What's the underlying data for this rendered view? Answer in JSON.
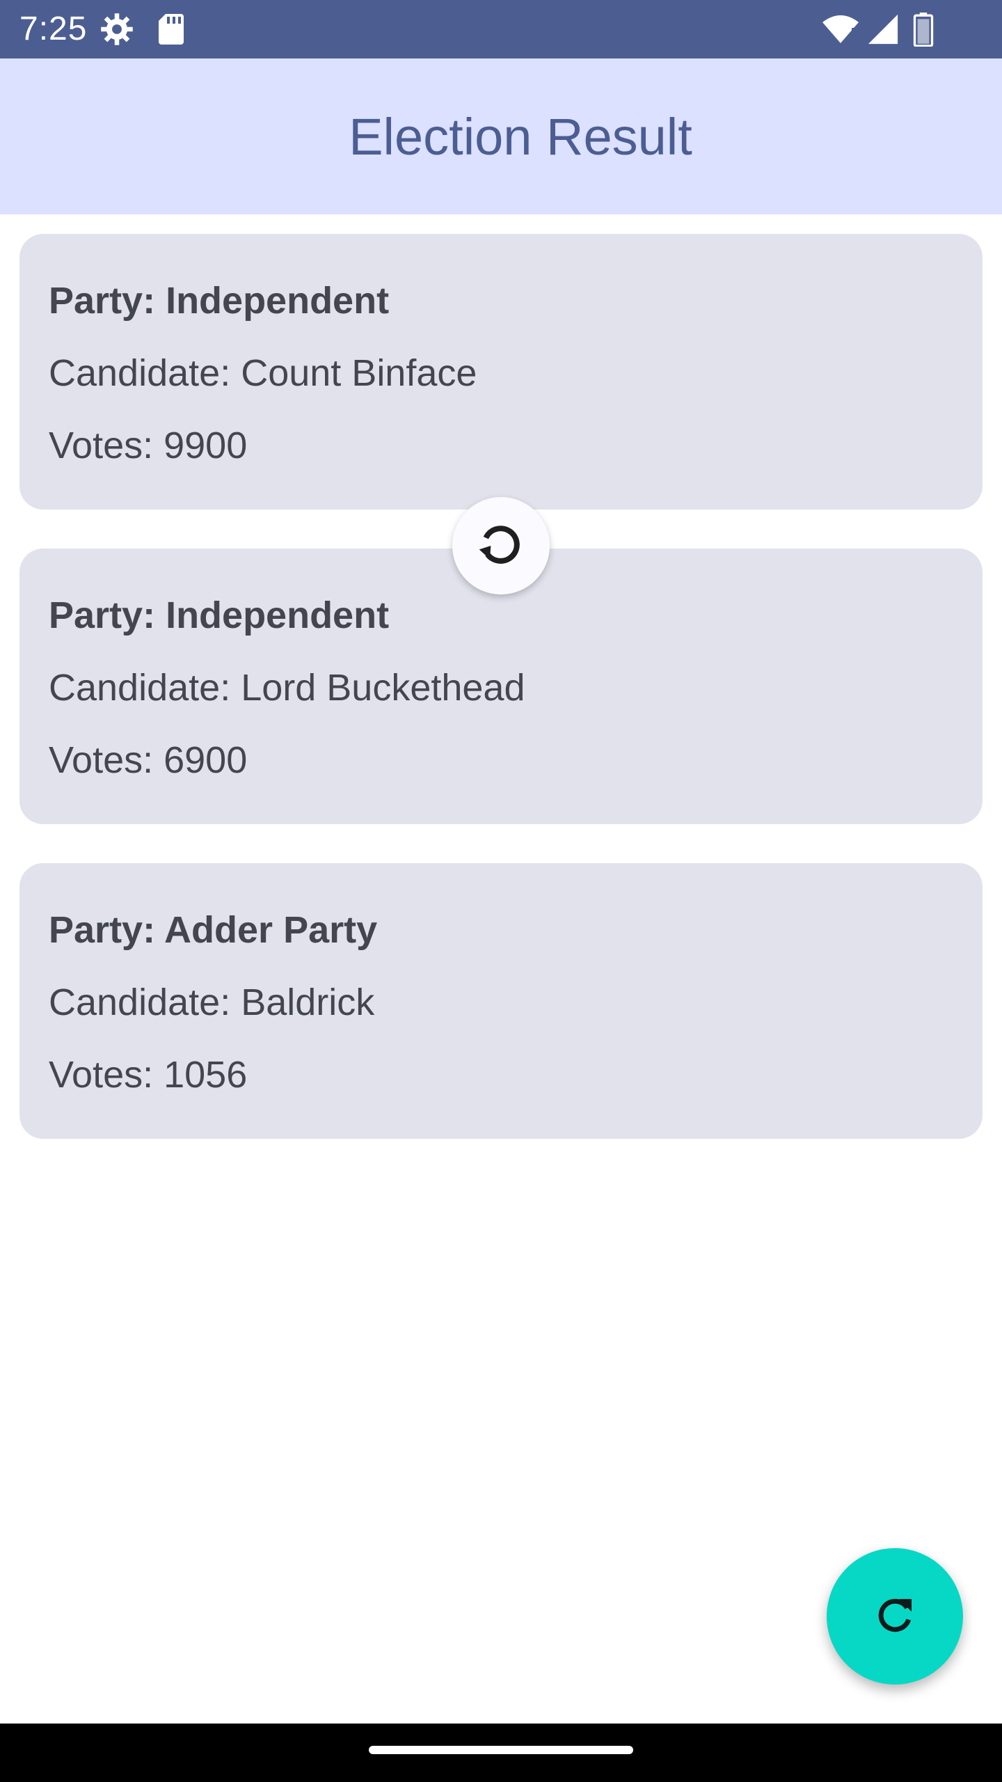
{
  "status_bar": {
    "time": "7:25",
    "icons": [
      "settings-gear-icon",
      "sd-card-icon",
      "wifi-icon",
      "signal-icon",
      "battery-icon"
    ],
    "background": "#4c5d92"
  },
  "app_bar": {
    "title": "Election Result",
    "background": "#dbe1ff",
    "title_color": "#4c5d92"
  },
  "results": [
    {
      "party": "Party: Independent",
      "candidate": "Candidate: Count Binface",
      "votes": "Votes: 9900"
    },
    {
      "party": "Party: Independent",
      "candidate": "Candidate: Lord Buckethead",
      "votes": "Votes: 6900"
    },
    {
      "party": "Party: Adder Party",
      "candidate": "Candidate: Baldrick",
      "votes": "Votes: 1056"
    }
  ],
  "refresh_indicator": {
    "icon": "refresh-spinner-icon"
  },
  "fab": {
    "icon": "refresh-icon",
    "color": "#07d8c6"
  },
  "colors": {
    "card_background": "#e1e2ec",
    "card_text": "#44464f"
  }
}
